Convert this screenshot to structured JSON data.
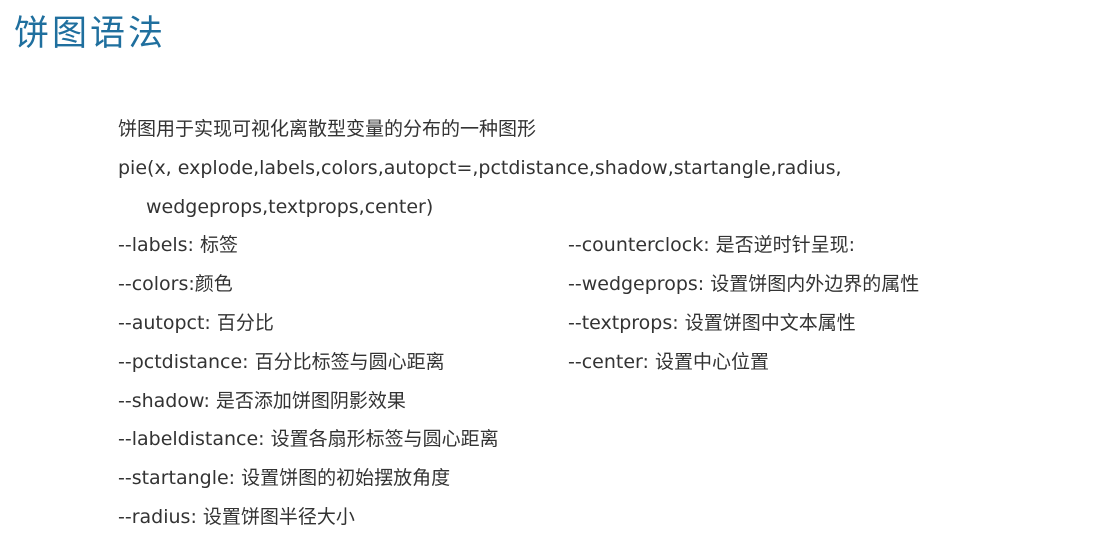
{
  "title": "饼图语法",
  "intro": "饼图用于实现可视化离散型变量的分布的一种图形",
  "signature_line1": "pie(x, explode,labels,colors,autopct=,pctdistance,shadow,startangle,radius,",
  "signature_line2": "wedgeprops,textprops,center)",
  "params_left": [
    "--labels: 标签",
    "--colors:颜色",
    "--autopct: 百分比",
    "--pctdistance: 百分比标签与圆心距离",
    "--shadow: 是否添加饼图阴影效果",
    "--labeldistance: 设置各扇形标签与圆心距离",
    "--startangle: 设置饼图的初始摆放角度",
    "--radius: 设置饼图半径大小"
  ],
  "params_right": [
    "--counterclock: 是否逆时针呈现:",
    "--wedgeprops: 设置饼图内外边界的属性",
    "--textprops: 设置饼图中文本属性",
    "--center: 设置中心位置"
  ]
}
